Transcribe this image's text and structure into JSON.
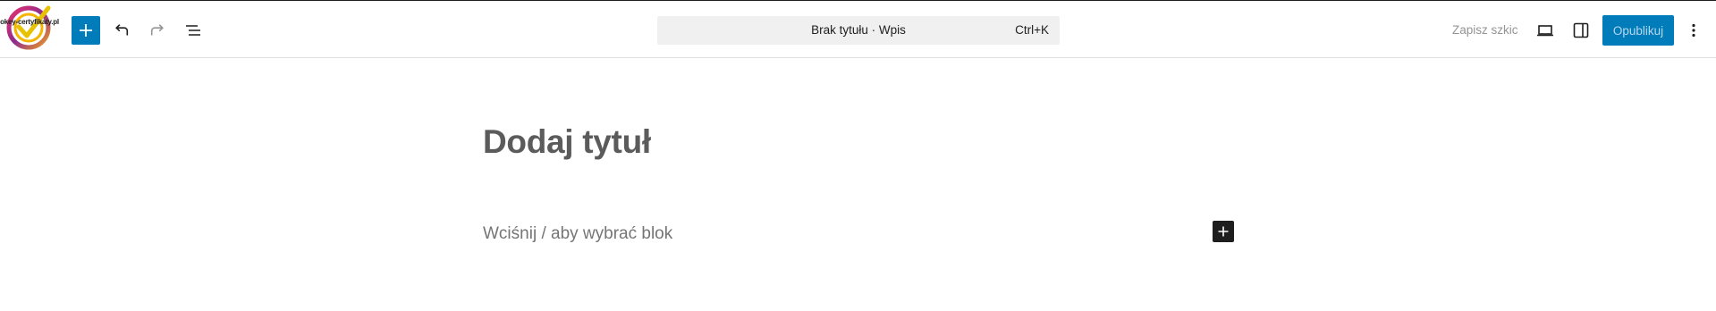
{
  "header": {
    "logo_text": "okey-certyfikaty.pl",
    "add_block_icon": "plus-icon",
    "undo_icon": "undo-icon",
    "redo_icon": "redo-icon",
    "document_overview_icon": "list-view-icon",
    "command_bar": {
      "title": "Brak tytułu · Wpis",
      "shortcut": "Ctrl+K"
    },
    "save_draft_label": "Zapisz szkic",
    "preview_icon": "desktop-preview-icon",
    "settings_icon": "sidebar-settings-icon",
    "publish_label": "Opublikuj",
    "options_icon": "more-vertical-icon"
  },
  "editor": {
    "title_placeholder": "Dodaj tytuł",
    "block_placeholder": "Wciśnij / aby wybrać blok",
    "inserter_icon": "plus-icon"
  },
  "colors": {
    "accent": "#007cba",
    "dark": "#1e1e1e"
  }
}
